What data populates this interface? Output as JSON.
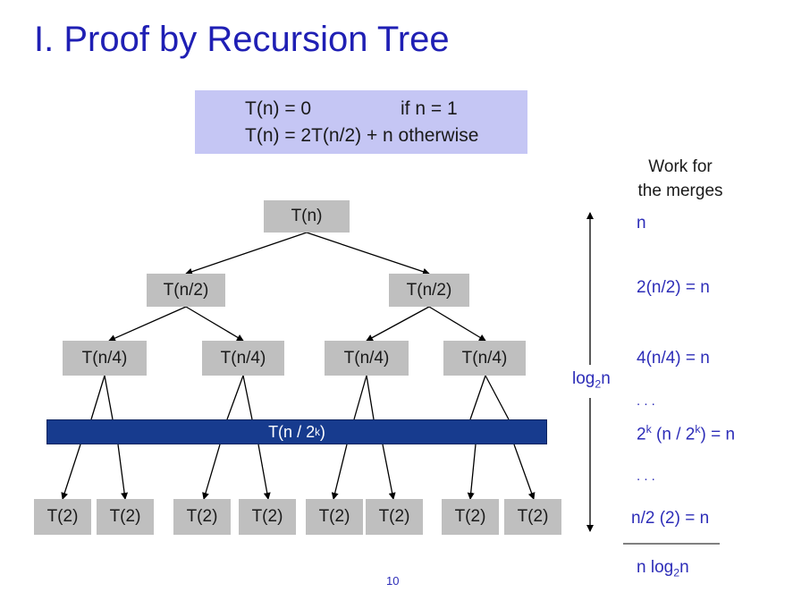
{
  "title": "I. Proof by Recursion Tree",
  "recurrence": {
    "line1_left": "T(n) = 0",
    "line1_right": "if n = 1",
    "line2": "T(n) = 2T(n/2) + n otherwise"
  },
  "tree": {
    "root": "T(n)",
    "level1": [
      "T(n/2)",
      "T(n/2)"
    ],
    "level2": [
      "T(n/4)",
      "T(n/4)",
      "T(n/4)",
      "T(n/4)"
    ],
    "level_k": "T(n / 2",
    "level_k_sup": "k",
    "level_k_end": ")",
    "leaves": [
      "T(2)",
      "T(2)",
      "T(2)",
      "T(2)",
      "T(2)",
      "T(2)",
      "T(2)",
      "T(2)"
    ]
  },
  "work": {
    "heading_line1": "Work for",
    "heading_line2": "the merges",
    "row0": "n",
    "row1": "2(n/2) = n",
    "row2": "4(n/4) = n",
    "dots1": ". . .",
    "rowk_a": "2",
    "rowk_sup1": "k",
    "rowk_b": " (n / 2",
    "rowk_sup2": "k",
    "rowk_c": ") = n",
    "dots2": ". . .",
    "row_last": "n/2 (2) = n",
    "total_a": "n log",
    "total_sub": "2",
    "total_b": "n"
  },
  "height_label": {
    "text_a": "log",
    "sub": "2",
    "text_b": "n"
  },
  "page_number": "10",
  "colors": {
    "title": "#1f1fb4",
    "recurrence_box": "#c5c6f4",
    "node": "#bfbfbf",
    "band": "#173b8e",
    "work_text": "#2d2db8"
  }
}
